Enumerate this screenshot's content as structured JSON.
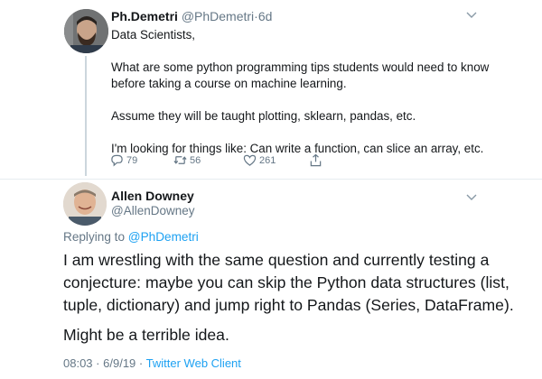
{
  "tweet1": {
    "name": "Ph.Demetri",
    "handle": "@PhDemetri",
    "age": "6d",
    "lines": [
      "Data Scientists,",
      "What are some python programming tips students would need to know",
      "before taking a course on machine learning.",
      "Assume they will be taught plotting, sklearn, pandas, etc.",
      "I'm looking for things like: Can write a function, can slice an array, etc."
    ],
    "replies": "79",
    "retweets": "56",
    "likes": "261"
  },
  "tweet2": {
    "name": "Allen Downey",
    "handle": "@AllenDowney",
    "replying_label": "Replying to",
    "replying_handle": "@PhDemetri",
    "paragraph1_lines": [
      "I am wrestling with the same question and currently testing a",
      "conjecture: maybe you can skip the Python data structures (list,",
      "tuple, dictionary) and jump right to Pandas (Series, DataFrame)."
    ],
    "paragraph2": "Might be a terrible idea.",
    "time": "08:03",
    "date": "6/9/19",
    "app": "Twitter Web Client"
  },
  "icons": {
    "reply": "reply-icon",
    "retweet": "retweet-icon",
    "like": "heart-icon",
    "share": "share-icon",
    "menu": "chevron-down-icon"
  },
  "colors": {
    "link": "#1da1f2",
    "secondary": "#657786",
    "text": "#14171a"
  }
}
